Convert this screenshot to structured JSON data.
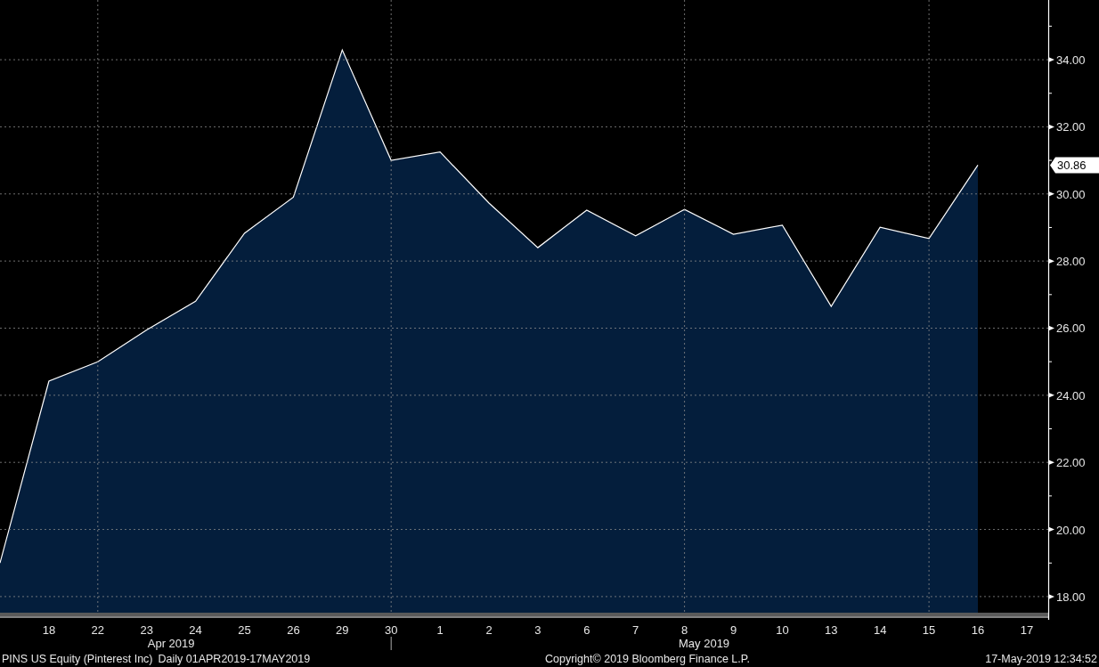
{
  "chart": {
    "chart_data": {
      "type": "area",
      "grid": true,
      "categories": [
        null,
        "18",
        "22",
        "23",
        "24",
        "25",
        "26",
        "29",
        "30",
        "1",
        "2",
        "3",
        "6",
        "7",
        "8",
        "9",
        "10",
        "13",
        "14",
        "15",
        "16",
        "17"
      ],
      "series": [
        {
          "name": "PINS US Equity (Pinterest Inc)",
          "color": "#041e3c",
          "values": [
            19.0,
            24.42,
            25.0,
            25.95,
            26.8,
            28.83,
            29.9,
            34.29,
            31.0,
            31.25,
            29.73,
            28.4,
            29.52,
            28.75,
            29.54,
            28.8,
            29.07,
            26.65,
            29.01,
            28.67,
            30.86,
            null
          ]
        }
      ],
      "ylim": [
        17.52,
        35.78
      ],
      "yticks": [
        {
          "value": 18,
          "label": "18.00"
        },
        {
          "value": 20,
          "label": "20.00"
        },
        {
          "value": 22,
          "label": "22.00"
        },
        {
          "value": 24,
          "label": "24.00"
        },
        {
          "value": 26,
          "label": "26.00"
        },
        {
          "value": 28,
          "label": "28.00"
        },
        {
          "value": 30,
          "label": "30.00"
        },
        {
          "value": 32,
          "label": "32.00"
        },
        {
          "value": 34,
          "label": "34.00"
        }
      ]
    },
    "last_price": "30.86",
    "month_labels": [
      "Apr 2019",
      "May 2019"
    ]
  },
  "footer": {
    "period": "Daily 01APR2019-17MAY2019",
    "copyright": "Copyright© 2019 Bloomberg Finance L.P.",
    "timestamp": "17-May-2019 12:34:52"
  }
}
